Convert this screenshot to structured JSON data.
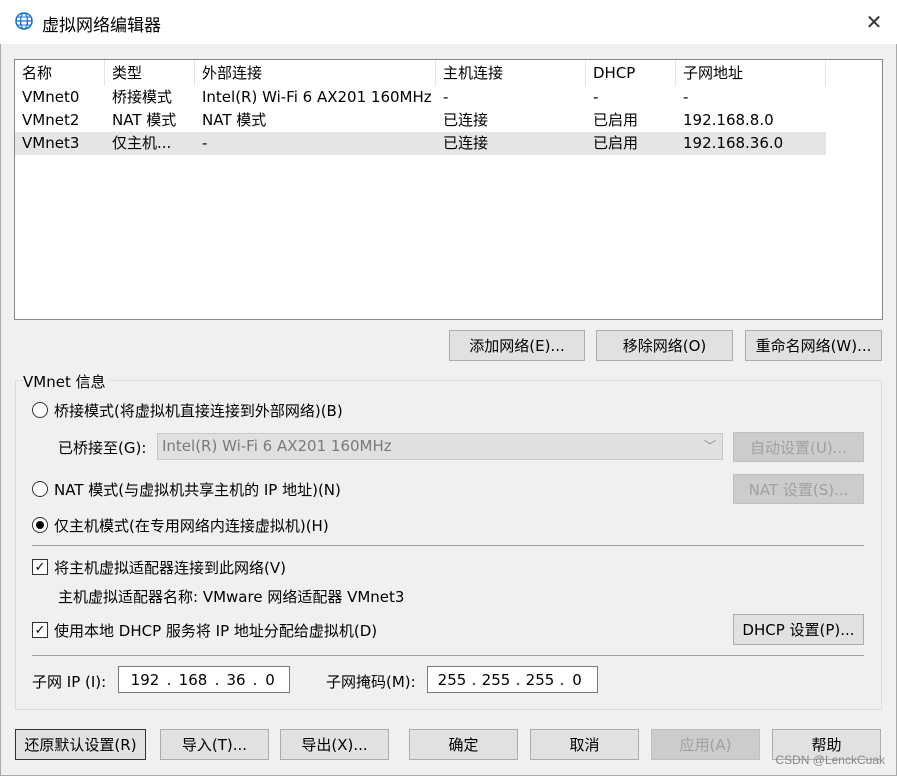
{
  "window": {
    "title": "虚拟网络编辑器",
    "close_glyph": "✕"
  },
  "table": {
    "headers": [
      "名称",
      "类型",
      "外部连接",
      "主机连接",
      "DHCP",
      "子网地址"
    ],
    "rows": [
      [
        "VMnet0",
        "桥接模式",
        "Intel(R) Wi-Fi 6 AX201 160MHz",
        "-",
        "-",
        "-"
      ],
      [
        "VMnet2",
        "NAT 模式",
        "NAT 模式",
        "已连接",
        "已启用",
        "192.168.8.0"
      ],
      [
        "VMnet3",
        "仅主机...",
        "-",
        "已连接",
        "已启用",
        "192.168.36.0"
      ]
    ],
    "selected_row": 2
  },
  "list_buttons": {
    "add": "添加网络(E)...",
    "remove": "移除网络(O)",
    "rename": "重命名网络(W)..."
  },
  "vmnet_info": {
    "title": "VMnet 信息",
    "bridge_radio": "桥接模式(将虚拟机直接连接到外部网络)(B)",
    "bridged_to_label": "已桥接至(G):",
    "bridged_to_value": "Intel(R) Wi-Fi 6 AX201 160MHz",
    "auto_settings": "自动设置(U)...",
    "nat_radio": "NAT 模式(与虚拟机共享主机的 IP 地址)(N)",
    "nat_settings": "NAT 设置(S)...",
    "host_only_radio": "仅主机模式(在专用网络内连接虚拟机)(H)",
    "selected_mode": "host-only",
    "connect_adapter_check": "将主机虚拟适配器连接到此网络(V)",
    "adapter_name": "主机虚拟适配器名称: VMware 网络适配器 VMnet3",
    "dhcp_check": "使用本地 DHCP 服务将 IP 地址分配给虚拟机(D)",
    "dhcp_settings": "DHCP 设置(P)...",
    "subnet_ip_label": "子网 IP (I):",
    "subnet_ip": [
      "192",
      "168",
      "36",
      "0"
    ],
    "subnet_mask_label": "子网掩码(M):",
    "subnet_mask": [
      "255",
      "255",
      "255",
      "0"
    ]
  },
  "bottom_buttons": {
    "restore": "还原默认设置(R)",
    "import": "导入(T)...",
    "export": "导出(X)...",
    "ok": "确定",
    "cancel": "取消",
    "apply": "应用(A)",
    "help": "帮助"
  },
  "watermark": "CSDN @LenckCuak",
  "colors": {
    "selected_row": "#e5e5e5",
    "disabled_text": "#a0a0a0",
    "icon_blue": "#1a73c9"
  }
}
